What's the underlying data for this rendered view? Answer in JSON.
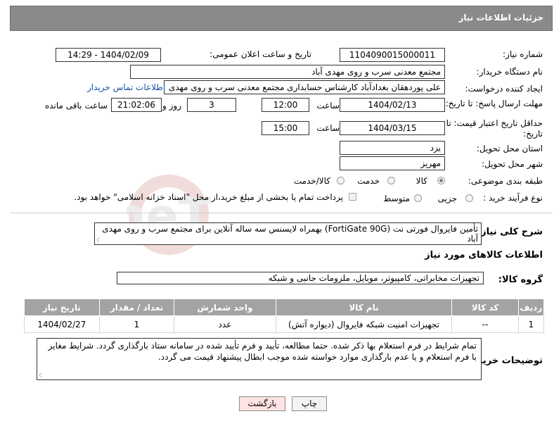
{
  "header": {
    "title": "جزئیات اطلاعات نیاز"
  },
  "labels": {
    "need_number": "شماره نیاز:",
    "announce_datetime": "تاریخ و ساعت اعلان عمومی:",
    "buyer_org": "نام دستگاه خریدار:",
    "requester": "ایجاد کننده درخواست:",
    "deadline_send": "مهلت ارسال پاسخ: تا تاریخ:",
    "price_validity": "حداقل تاریخ اعتبار قیمت: تا تاریخ:",
    "time": "ساعت",
    "day_and": "روز و",
    "remaining": "ساعت باقی مانده",
    "province": "استان محل تحویل:",
    "city": "شهر محل تحویل:",
    "category": "طبقه بندی موضوعی:",
    "purchase_type": "نوع فرآیند خرید :",
    "general_desc": "شرح کلی نیاز:",
    "goods_info": "اطلاعات کالاهای مورد نیاز",
    "goods_group": "گروه کالا:",
    "buyer_notes": "توضیحات خریدار:"
  },
  "values": {
    "need_number": "1104090015000011",
    "announce_datetime": "1404/02/09 - 14:29",
    "buyer_org": "مجتمع معدنی سرب و روی مهدی آباد",
    "requester": "علی پوردهقان بغدادآباد کارشناس حسابداری مجتمع معدنی سرب و روی مهدی",
    "contact_link": "اطلاعات تماس خریدار",
    "deadline_date": "1404/02/13",
    "deadline_time": "12:00",
    "days": "3",
    "remaining_time": "21:02:06",
    "validity_date": "1404/03/15",
    "validity_time": "15:00",
    "province": "یزد",
    "city": "مهریز",
    "general_desc": "تأمین فایروال فورتی نت (FortiGate 90G) بهمراه لایسنس سه ساله آنلاین برای مجتمع سرب و روی مهدی آباد",
    "goods_group": "تجهیزات مخابراتی، کامپیوتر، موبایل، ملزومات جانبی و شبکه",
    "buyer_notes": "تمام شرایط در فرم استعلام بها ذکر شده. حتما مطالعه، تأیید و فرم تأیید شده در سامانه ستاد بارگذاری گردد. شرایط مغایر با فرم استعلام و یا عدم بارگذاری موارد خواسته شده موجب ابطال پیشنهاد قیمت می گردد."
  },
  "category_options": [
    {
      "label": "کالا",
      "selected": true
    },
    {
      "label": "خدمت",
      "selected": false
    },
    {
      "label": "کالا/خدمت",
      "selected": false
    }
  ],
  "purchase_options": [
    {
      "label": "جزیی",
      "selected": false
    },
    {
      "label": "متوسط",
      "selected": false
    }
  ],
  "payment_note": "پرداخت تمام یا بخشی از مبلغ خرید،از محل \"اسناد خزانه اسلامی\" خواهد بود.",
  "table": {
    "headers": [
      "ردیف",
      "کد کالا",
      "نام کالا",
      "واحد شمارش",
      "تعداد / مقدار",
      "تاریخ نیاز"
    ],
    "rows": [
      [
        "1",
        "--",
        "تجهیزات امنیت شبکه فایروال (دیواره آتش)",
        "عدد",
        "1",
        "1404/02/27"
      ]
    ]
  },
  "buttons": {
    "print": "چاپ",
    "back": "بازگشت"
  },
  "watermark": "AriaTender.neT",
  "colors": {
    "header_bg": "#8a8a8a",
    "table_header_bg": "#a3a3a3",
    "link": "#1a4fa0",
    "back_button_bg": "#fde3e3"
  }
}
